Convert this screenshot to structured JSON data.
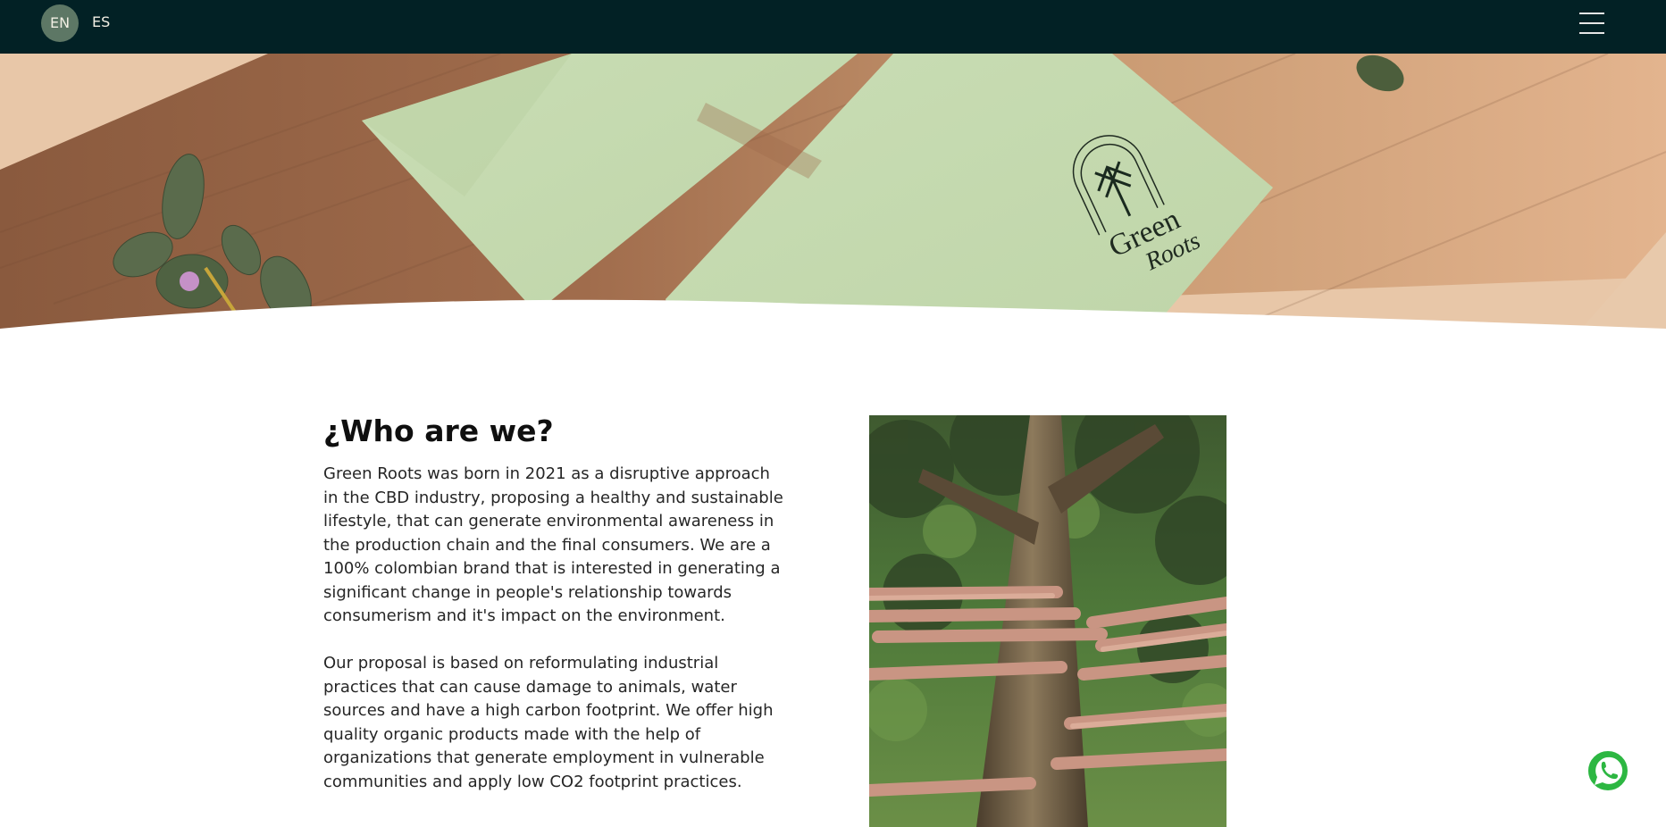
{
  "header": {
    "languages": [
      {
        "label": "EN",
        "active": true
      },
      {
        "label": "ES",
        "active": false
      }
    ],
    "menu_icon": "hamburger-menu-icon",
    "colors": {
      "background": "#022125",
      "active_lang_bg": "#5d7765"
    }
  },
  "hero": {
    "logo_text_line1": "Green",
    "logo_text_line2": "Roots",
    "logo_icon": "palm-tree-icon"
  },
  "about": {
    "title": "¿Who are we?",
    "paragraphs": [
      "Green Roots was born in 2021 as a disruptive approach in the CBD industry, proposing a healthy and sustainable lifestyle, that can generate environmental awareness in the production chain and the final consumers. We are a 100% colombian brand that is interested in generating a significant change in people's relationship towards consumerism and it's impact on the environment.",
      "Our proposal is based on reformulating industrial practices that can cause damage to animals, water sources and have a high carbon footprint. We offer high quality organic products made with the help of organizations that generate employment in vulnerable communities and apply low CO2 footprint practices."
    ]
  },
  "floating": {
    "whatsapp_icon": "whatsapp-icon",
    "color": "#2db742"
  }
}
